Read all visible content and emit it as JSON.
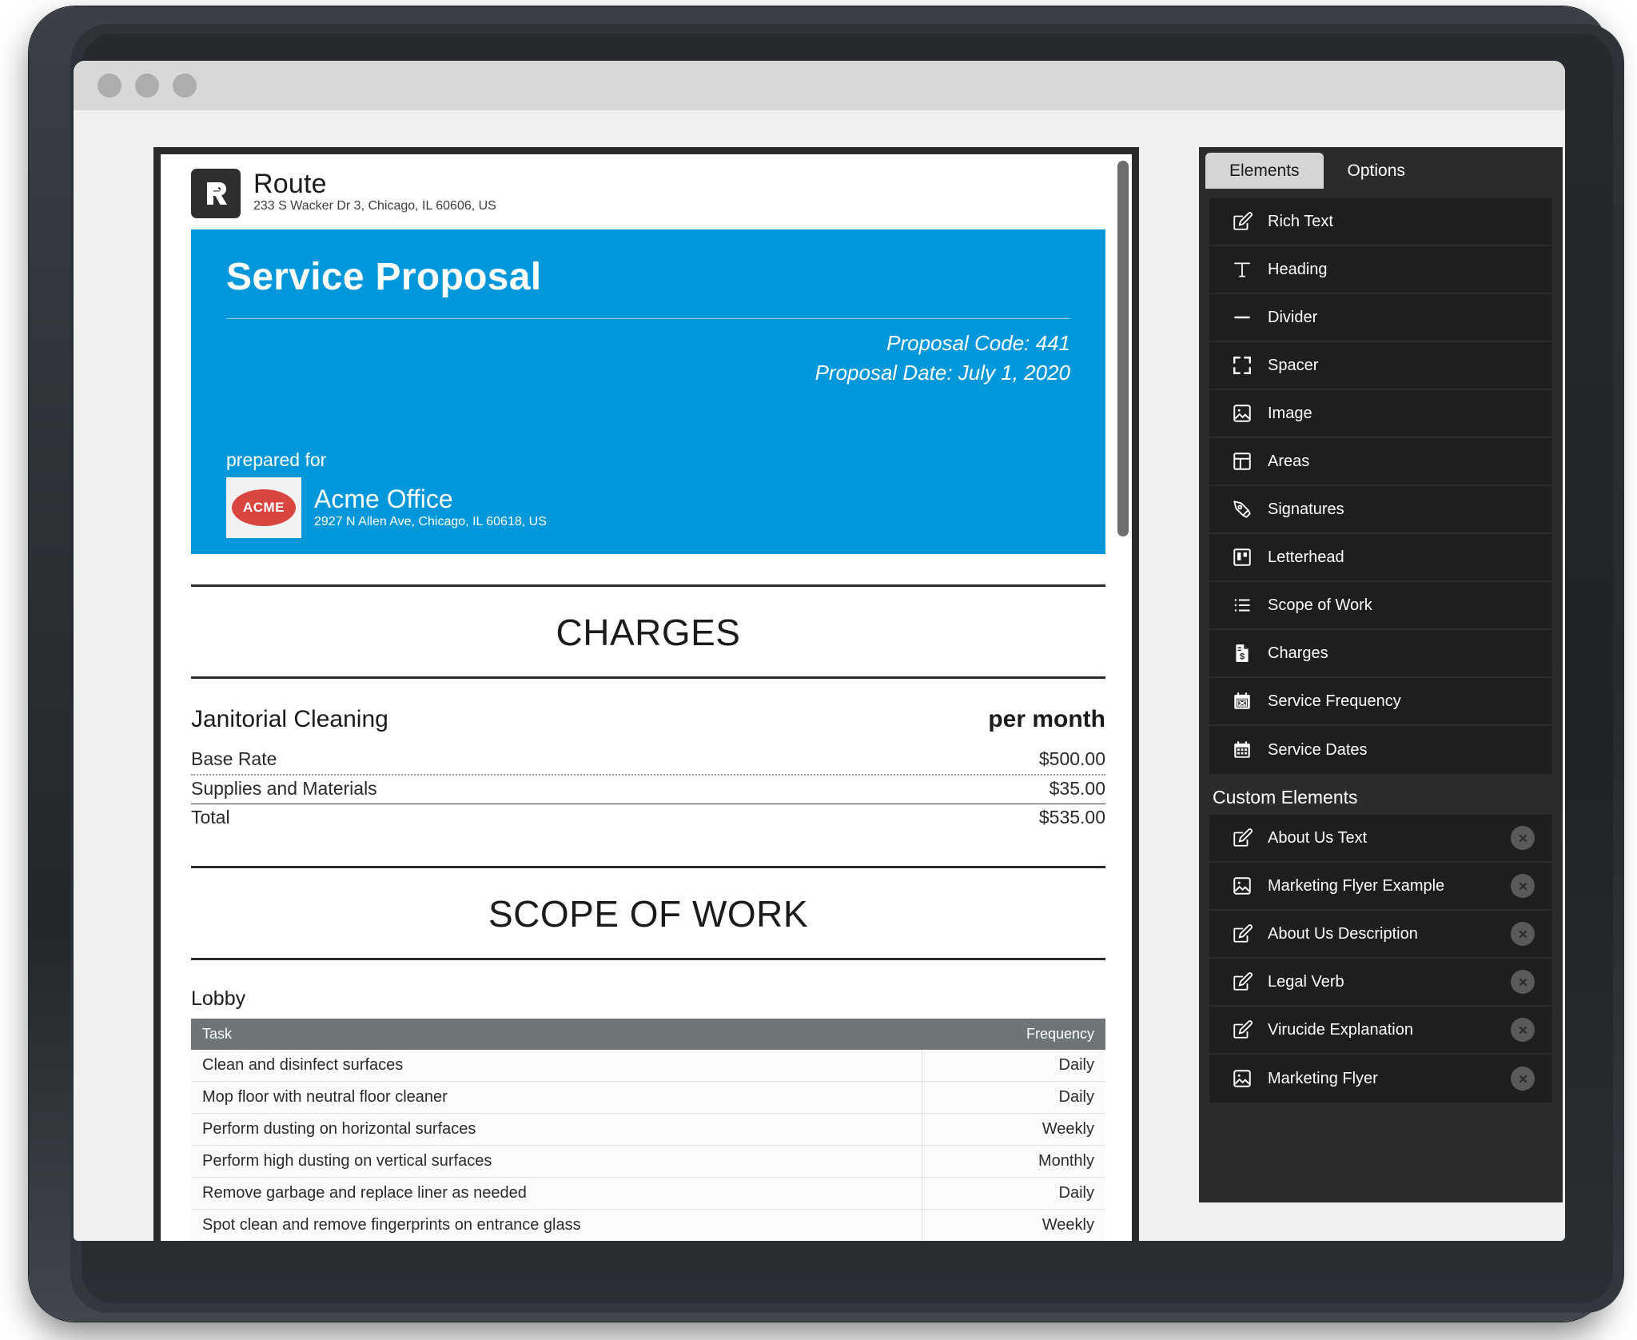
{
  "window": {
    "traffic_lights": [
      "close",
      "minimize",
      "maximize"
    ]
  },
  "document": {
    "letterhead": {
      "company_name": "Route",
      "company_address": "233 S Wacker Dr 3, Chicago, IL 60606, US",
      "logo_letter": "R"
    },
    "hero": {
      "title": "Service Proposal",
      "proposal_code": "Proposal Code: 441",
      "proposal_date": "Proposal Date: July 1, 2020",
      "prepared_for_label": "prepared for",
      "client_logo_text": "ACME",
      "client_name": "Acme Office",
      "client_address": "2927 N Allen Ave, Chicago, IL 60618, US",
      "accent_color": "#0098da"
    },
    "charges": {
      "section_title": "CHARGES",
      "service_name": "Janitorial Cleaning",
      "period_label": "per month",
      "rows": [
        {
          "label": "Base Rate",
          "amount": "$500.00"
        },
        {
          "label": "Supplies and Materials",
          "amount": "$35.00"
        },
        {
          "label": "Total",
          "amount": "$535.00"
        }
      ]
    },
    "scope_of_work": {
      "section_title": "SCOPE OF WORK",
      "area_name": "Lobby",
      "columns": [
        "Task",
        "Frequency"
      ],
      "rows": [
        {
          "task": "Clean and disinfect surfaces",
          "frequency": "Daily"
        },
        {
          "task": "Mop floor with neutral floor cleaner",
          "frequency": "Daily"
        },
        {
          "task": "Perform dusting on horizontal surfaces",
          "frequency": "Weekly"
        },
        {
          "task": "Perform high dusting on vertical surfaces",
          "frequency": "Monthly"
        },
        {
          "task": "Remove garbage and replace liner as needed",
          "frequency": "Daily"
        },
        {
          "task": "Spot clean and remove fingerprints on entrance glass",
          "frequency": "Weekly"
        }
      ]
    }
  },
  "sidebar": {
    "tabs": [
      {
        "label": "Elements",
        "active": true
      },
      {
        "label": "Options",
        "active": false
      }
    ],
    "elements": [
      {
        "label": "Rich Text",
        "icon": "edit-square-icon"
      },
      {
        "label": "Heading",
        "icon": "text-t-icon"
      },
      {
        "label": "Divider",
        "icon": "horizontal-line-icon"
      },
      {
        "label": "Spacer",
        "icon": "expand-corners-icon"
      },
      {
        "label": "Image",
        "icon": "image-icon"
      },
      {
        "label": "Areas",
        "icon": "layout-panels-icon"
      },
      {
        "label": "Signatures",
        "icon": "pen-nib-icon"
      },
      {
        "label": "Letterhead",
        "icon": "letterhead-icon"
      },
      {
        "label": "Scope of Work",
        "icon": "bullet-list-icon"
      },
      {
        "label": "Charges",
        "icon": "invoice-dollar-icon"
      },
      {
        "label": "Service Frequency",
        "icon": "calendar-x-icon"
      },
      {
        "label": "Service Dates",
        "icon": "calendar-grid-icon"
      }
    ],
    "custom_elements_header": "Custom Elements",
    "custom_elements": [
      {
        "label": "About Us Text",
        "icon": "edit-square-icon"
      },
      {
        "label": "Marketing Flyer Example",
        "icon": "image-icon"
      },
      {
        "label": "About Us Description",
        "icon": "edit-square-icon"
      },
      {
        "label": "Legal Verb",
        "icon": "edit-square-icon"
      },
      {
        "label": "Virucide Explanation",
        "icon": "edit-square-icon"
      },
      {
        "label": "Marketing Flyer",
        "icon": "image-icon"
      }
    ]
  }
}
